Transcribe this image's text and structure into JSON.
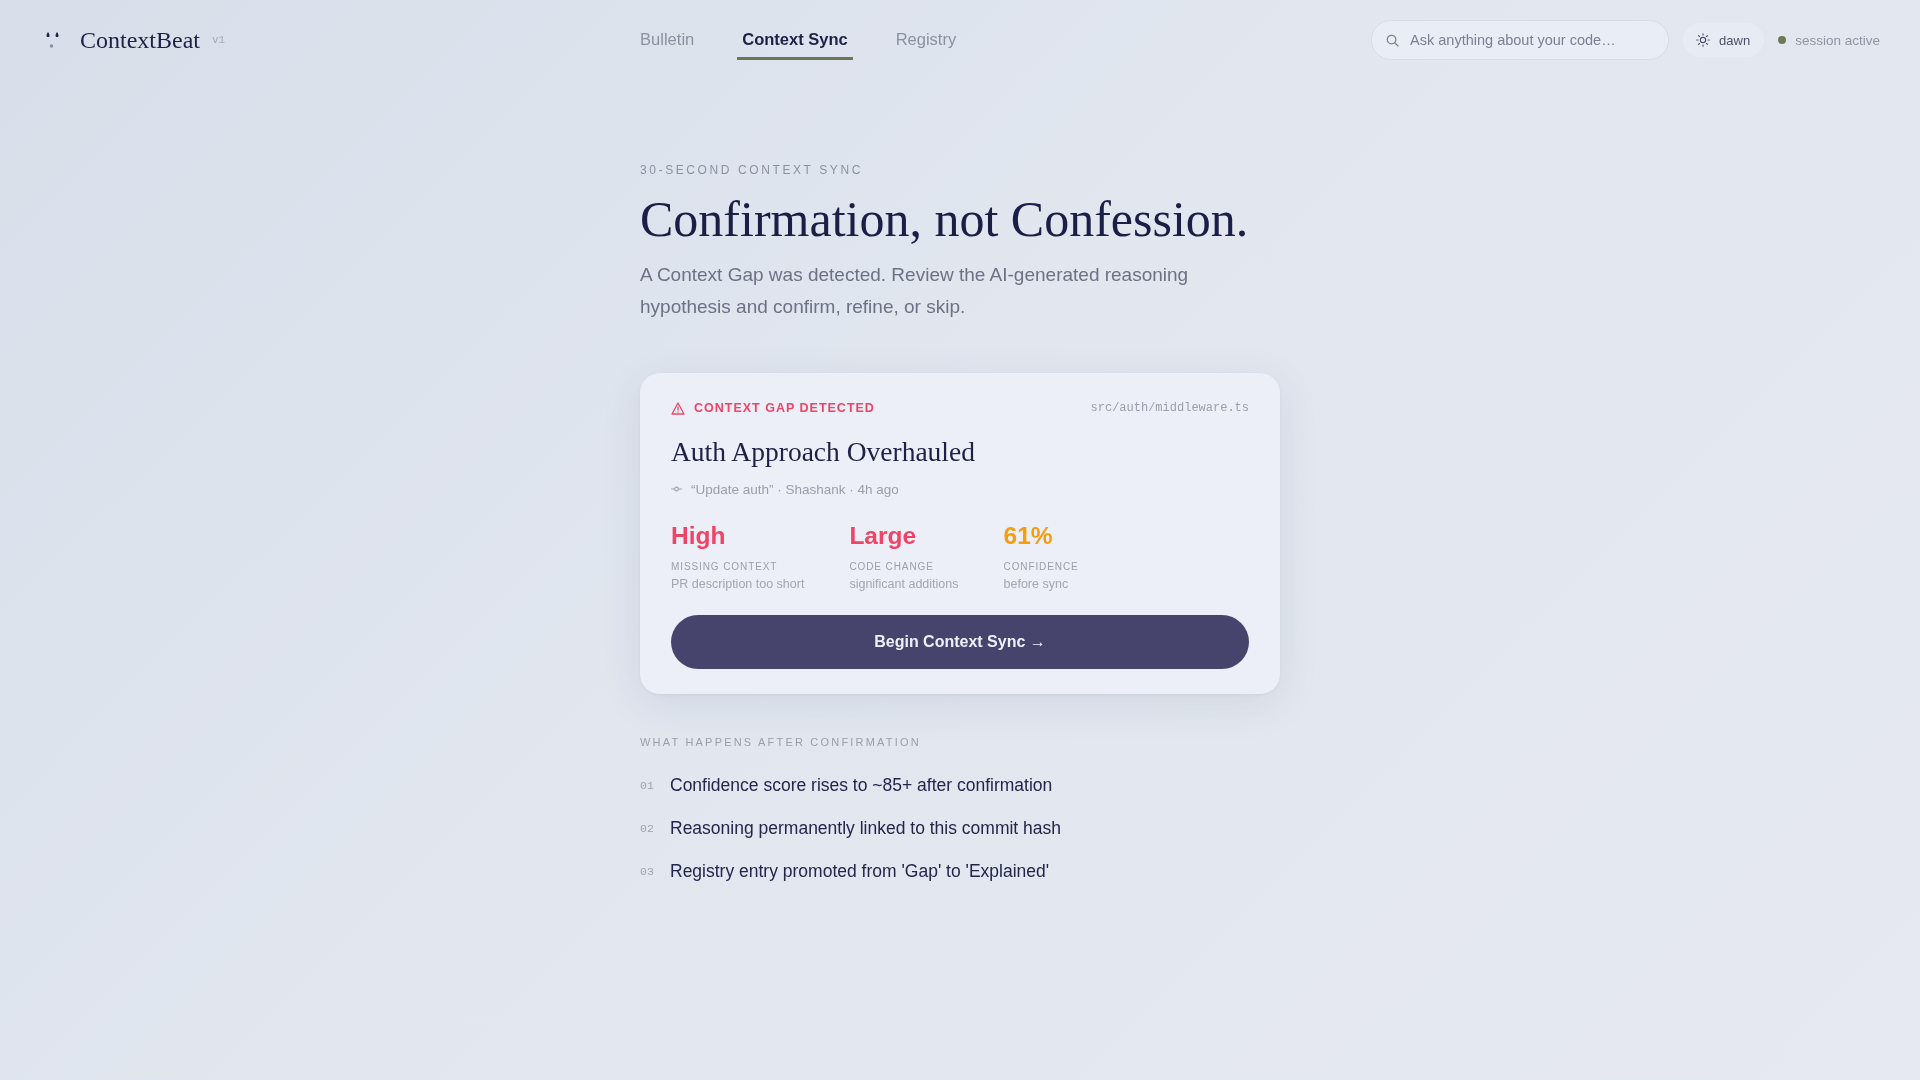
{
  "header": {
    "brand": {
      "name": "ContextBeat",
      "version": "v1"
    },
    "nav": [
      {
        "label": "Bulletin",
        "selected": false
      },
      {
        "label": "Context Sync",
        "selected": true
      },
      {
        "label": "Registry",
        "selected": false
      }
    ],
    "search": {
      "placeholder": "Ask anything about your code…"
    },
    "theme_button": {
      "label": "dawn"
    },
    "session": {
      "label": "session active"
    }
  },
  "hero": {
    "eyebrow": "30-SECOND CONTEXT SYNC",
    "title": "Confirmation, not Confession.",
    "subtitle": "A Context Gap was detected. Review the AI-generated reasoning hypothesis and confirm, refine, or skip."
  },
  "gap_card": {
    "alert": "CONTEXT GAP DETECTED",
    "file": "src/auth/middleware.ts",
    "title": "Auth Approach Overhauled",
    "commit": "“Update auth” · Shashank · 4h ago",
    "metrics": [
      {
        "value": "High",
        "label": "MISSING CONTEXT",
        "note": "PR description too short",
        "color": "#ef4466"
      },
      {
        "value": "Large",
        "label": "CODE CHANGE",
        "note": "significant additions",
        "color": "#ef4466"
      },
      {
        "value": "61%",
        "label": "CONFIDENCE",
        "note": "before sync",
        "color": "#f59e0b"
      }
    ],
    "button": "Begin Context Sync →"
  },
  "after": {
    "heading": "WHAT HAPPENS AFTER CONFIRMATION",
    "steps": [
      {
        "number": "01",
        "text": "Confidence score rises to ~85+ after confirmation"
      },
      {
        "number": "02",
        "text": "Reasoning permanently linked to this commit hash"
      },
      {
        "number": "03",
        "text": "Registry entry promoted from 'Gap' to 'Explained'"
      }
    ]
  }
}
